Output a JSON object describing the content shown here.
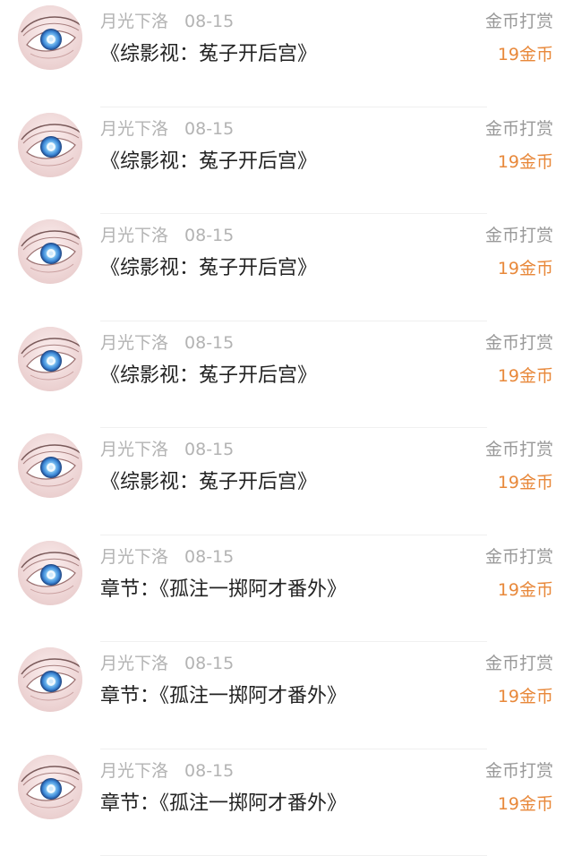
{
  "colors": {
    "accent": "#e8883a",
    "muted": "#b3b3b3",
    "title": "#222222"
  },
  "entries": [
    {
      "user": "月光下洛",
      "date": "08-15",
      "title": "《综影视：菟子开后宫》",
      "reward_label": "金币打赏",
      "amount": "19金币",
      "avatar_icon": "eye-avatar"
    },
    {
      "user": "月光下洛",
      "date": "08-15",
      "title": "《综影视：菟子开后宫》",
      "reward_label": "金币打赏",
      "amount": "19金币",
      "avatar_icon": "eye-avatar"
    },
    {
      "user": "月光下洛",
      "date": "08-15",
      "title": "《综影视：菟子开后宫》",
      "reward_label": "金币打赏",
      "amount": "19金币",
      "avatar_icon": "eye-avatar"
    },
    {
      "user": "月光下洛",
      "date": "08-15",
      "title": "《综影视：菟子开后宫》",
      "reward_label": "金币打赏",
      "amount": "19金币",
      "avatar_icon": "eye-avatar"
    },
    {
      "user": "月光下洛",
      "date": "08-15",
      "title": "《综影视：菟子开后宫》",
      "reward_label": "金币打赏",
      "amount": "19金币",
      "avatar_icon": "eye-avatar"
    },
    {
      "user": "月光下洛",
      "date": "08-15",
      "title": "章节：《孤注一掷阿才番外》",
      "reward_label": "金币打赏",
      "amount": "19金币",
      "avatar_icon": "eye-avatar"
    },
    {
      "user": "月光下洛",
      "date": "08-15",
      "title": "章节：《孤注一掷阿才番外》",
      "reward_label": "金币打赏",
      "amount": "19金币",
      "avatar_icon": "eye-avatar"
    },
    {
      "user": "月光下洛",
      "date": "08-15",
      "title": "章节：《孤注一掷阿才番外》",
      "reward_label": "金币打赏",
      "amount": "19金币",
      "avatar_icon": "eye-avatar"
    }
  ]
}
